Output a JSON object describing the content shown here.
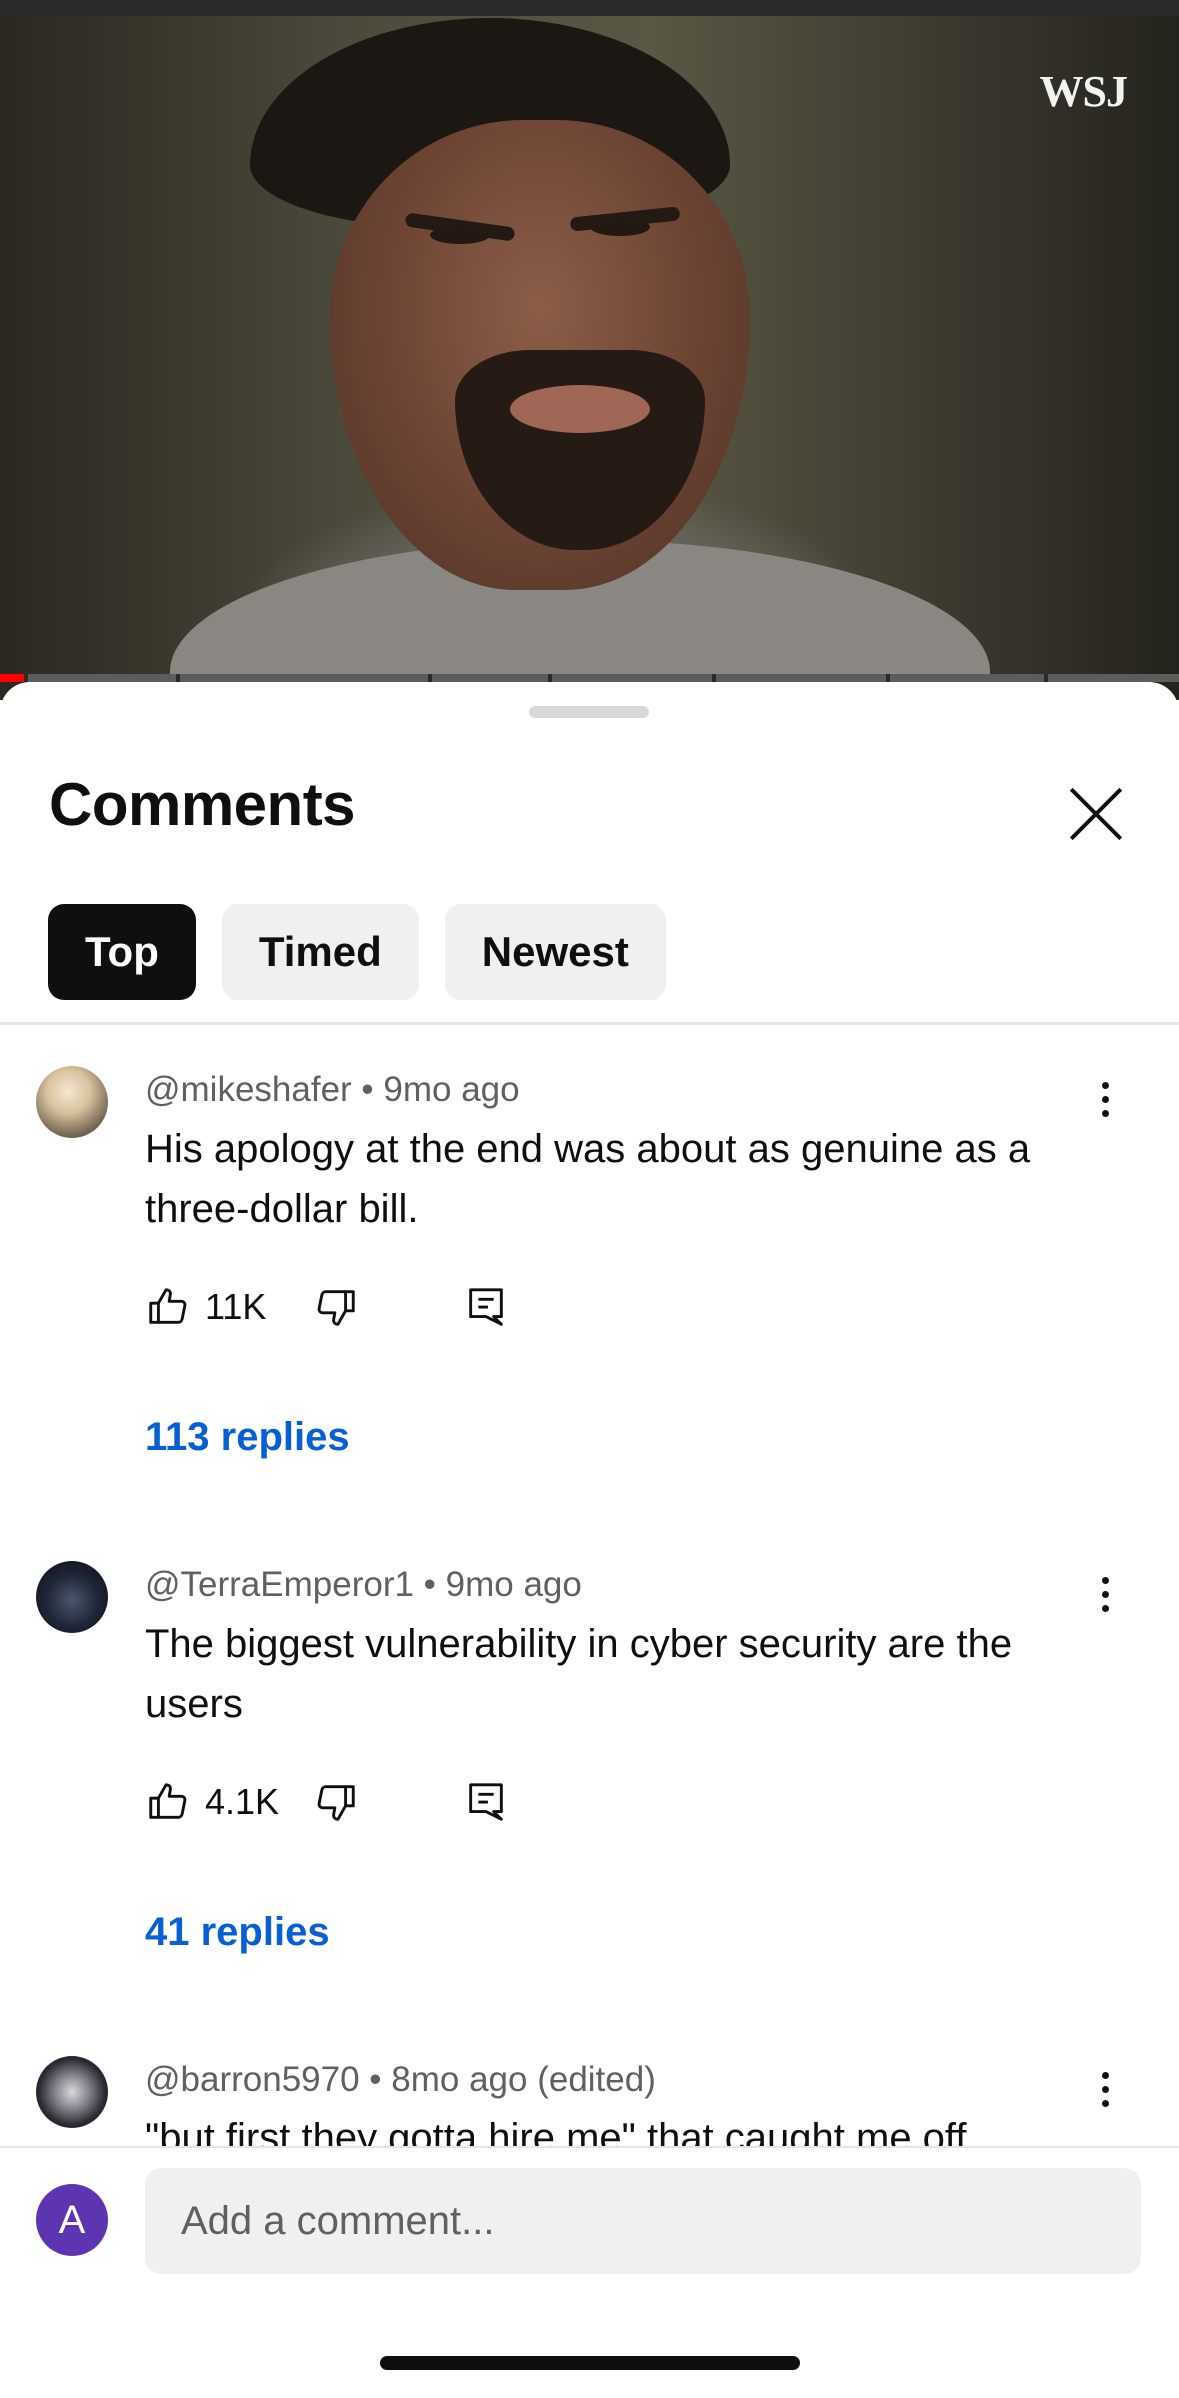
{
  "video": {
    "watermark": "WSJ",
    "progress_fraction": 0.02
  },
  "sheet": {
    "title": "Comments",
    "close_icon": "close-icon",
    "sort_tabs": [
      {
        "label": "Top",
        "selected": true
      },
      {
        "label": "Timed",
        "selected": false
      },
      {
        "label": "Newest",
        "selected": false
      }
    ]
  },
  "comments": [
    {
      "author": "@mikeshafer",
      "age": "9mo ago",
      "meta": "@mikeshafer • 9mo ago",
      "text": "His apology at the end was about as genuine as a three-dollar bill.",
      "likes": "11K",
      "replies": "113 replies"
    },
    {
      "author": "@TerraEmperor1",
      "age": "9mo ago",
      "meta": "@TerraEmperor1 • 9mo ago",
      "text": "The biggest vulnerability in cyber security are the users",
      "likes": "4.1K",
      "replies": "41 replies"
    },
    {
      "author": "@barron5970",
      "age": "8mo ago (edited)",
      "meta": "@barron5970 • 8mo ago (edited)",
      "text": "\"but first they gotta hire me\" that caught me off"
    }
  ],
  "composer": {
    "avatar_initial": "A",
    "avatar_color": "#5e35b1",
    "placeholder": "Add a comment..."
  },
  "colors": {
    "link": "#065fd4",
    "chip_active": "#0f0f0f",
    "chip": "#f0f0f0",
    "progress_played": "#ff0000"
  }
}
